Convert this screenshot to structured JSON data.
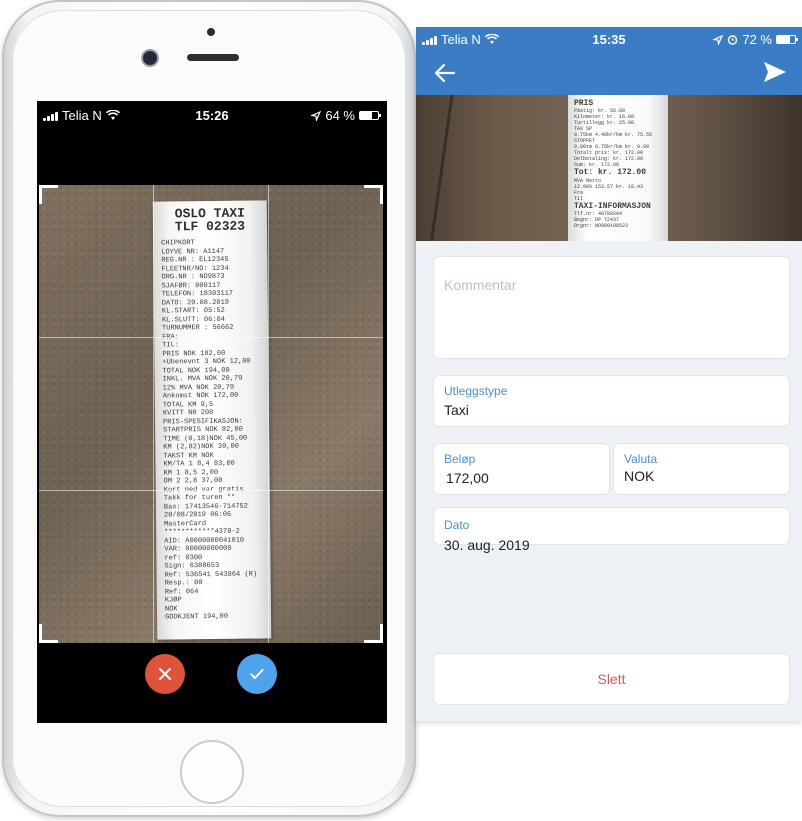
{
  "left_phone": {
    "status": {
      "carrier": "Telia N",
      "time": "15:26",
      "battery": "64 %",
      "battery_level": 0.64
    },
    "receipt": {
      "header_lines": [
        "OSLO TAXI",
        "TLF 02323"
      ],
      "lines": [
        "CHIPKORT",
        "LOYVE NR: A1147",
        "REG.NR : EL12345",
        "FLEETNR/NO: 1234",
        "ORG.NR : NO9873",
        "SJAFØR: 000117",
        "TELEFON: 18303117",
        "DATO: 20.08.2019",
        "KL.START: 05:52",
        "KL.SLUTT: 06:04",
        "TURNUMMER : 56662",
        "FRA:",
        "TIL:",
        "PRIS NOK 182,00",
        "+Ubenevnt 3 NOK 12,00",
        "TOTAL NOK 194,00",
        "INKL. MVA NOK 20,79",
        "12% MVA NOK 20,79",
        "Ankomst NOK 172,00",
        "TOTAL KM 9,5",
        "KVITT NR 208",
        "PRIS-SPESIFIKASJON:",
        "STARTPRIS NOK 82,00",
        "TIME (0,18)NOK 45,00",
        "KM (2,82)NOK 39,00",
        "TAKST KM NOK",
        "KM/TA 1 8,4 83,00",
        "KM 1 8,5 2,00",
        "OM 2 2,8 37,00",
        "Kort ned var gratis",
        "Takk for turen **",
        "Bax: 17413546-714752",
        "20/08/2019 06:06",
        "MasterCard",
        "************4378-2",
        "AID: A0000000041010",
        "VAR: 00000000000",
        "ref: 0300",
        "Sign: 6388653",
        "Ref: 536541 543864 (R)",
        "Resp.: 00",
        "Ref: 064",
        "KJØP",
        "NOK",
        "GODKJENT 194,00"
      ]
    },
    "cancel_icon": "close-icon",
    "confirm_icon": "check-icon"
  },
  "right_phone": {
    "status": {
      "carrier": "Telia N",
      "time": "15:35",
      "battery": "72 %",
      "battery_level": 0.72
    },
    "header": {
      "back_icon": "arrow-left-icon",
      "send_icon": "send-icon"
    },
    "photo_receipt": {
      "header": "PRIS",
      "lines": [
        "Påstig: kr. 56.00",
        "Kilometer: kr. 16.00",
        "Turtillegg kr. 25.00",
        "TAX SP",
        "0.75km 4.40kr/km kr. 75.55",
        "STOPPET",
        "0.00tm 0.75kr/km kr. 0.00",
        "Totalt pris: kr. 172.00",
        "Delbetaling: kr. 172.00",
        "Sum: kr. 172.00"
      ],
      "total": "Tot: kr. 172.00",
      "lines2": [
        "MVA Netto",
        "12.00% 153.57 kr. 18.43",
        "Fra",
        "Til"
      ],
      "footer": "TAXI-INFORMASJON",
      "footer_lines": [
        "Tlf.nr: 40789204",
        "Begnr: DP 72437",
        "Orgnr: NO989198523"
      ]
    },
    "comment": {
      "placeholder": "Kommentar",
      "value": ""
    },
    "expense_type": {
      "label": "Utleggstype",
      "value": "Taxi"
    },
    "amount": {
      "label": "Beløp",
      "value": "172,00"
    },
    "currency": {
      "label": "Valuta",
      "value": "NOK"
    },
    "date": {
      "label": "Dato",
      "value": "30. aug. 2019"
    },
    "delete_label": "Slett",
    "colors": {
      "accent": "#3a7dc4",
      "delete": "#e2574c",
      "label": "#4a90d9",
      "cancel": "#e0533b",
      "confirm": "#4da4ea"
    }
  }
}
